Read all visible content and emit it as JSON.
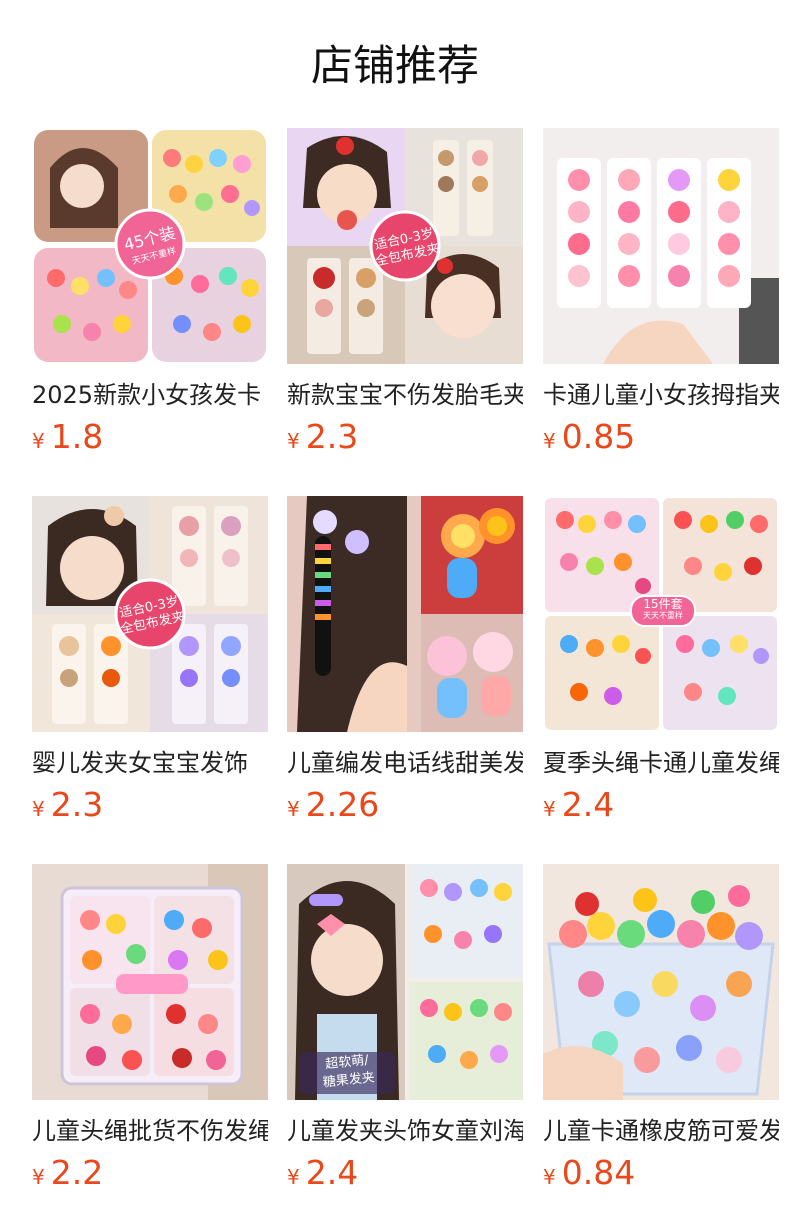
{
  "page": {
    "title": "店铺推荐"
  },
  "currency": "¥",
  "products": [
    {
      "name": "2025新款小女孩发卡",
      "price": "1.8",
      "image": "hair-clips-collage-45pcs-image",
      "badge": "45个装",
      "badge_sub": "天天不重样"
    },
    {
      "name": "新款宝宝不伤发胎毛夹",
      "price": "2.3",
      "image": "baby-hair-clip-collage-image",
      "badge": "适合0-3岁",
      "badge_sub": "全包布发夹"
    },
    {
      "name": "卡通儿童小女孩拇指夹",
      "price": "0.85",
      "image": "cartoon-thumb-clips-cards-image"
    },
    {
      "name": "婴儿发夹女宝宝发饰",
      "price": "2.3",
      "image": "baby-hair-accessory-collage-image",
      "badge": "适合0-3岁",
      "badge_sub": "全包布发夹"
    },
    {
      "name": "儿童编发电话线甜美发绳",
      "price": "2.26",
      "image": "braided-phone-cord-hair-ties-image"
    },
    {
      "name": "夏季头绳卡通儿童发绳",
      "price": "2.4",
      "image": "summer-cartoon-hair-ties-image",
      "badge": "15件套",
      "badge_sub": "天天不重样"
    },
    {
      "name": "儿童头绳批货不伤发绳",
      "price": "2.2",
      "image": "hair-tie-storage-box-image"
    },
    {
      "name": "儿童发夹头饰女童刘海夹",
      "price": "2.4",
      "image": "girl-hair-clips-collage-image",
      "badge": "超软萌/",
      "badge_sub": "糖果发夹"
    },
    {
      "name": "儿童卡通橡皮筋可爱发绳",
      "price": "0.84",
      "image": "rubber-band-bucket-image"
    }
  ]
}
